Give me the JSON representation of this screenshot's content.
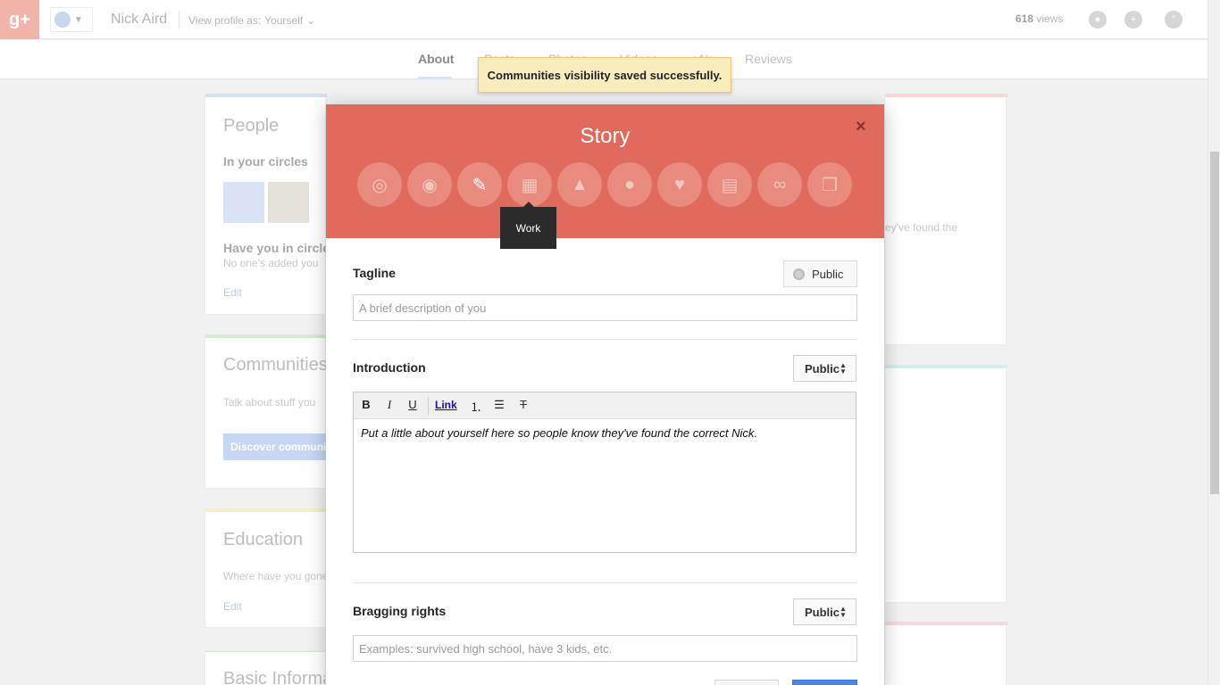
{
  "topbar": {
    "logo": "g+",
    "profile_name": "Nick Aird",
    "view_as_label": "View profile as:",
    "view_as_value": "Yourself",
    "views_count": "618",
    "views_label": "views",
    "icons": [
      "notifications-icon",
      "share-icon",
      "hangouts-icon"
    ]
  },
  "tabs": [
    {
      "label": "About",
      "active": true
    },
    {
      "label": "Posts"
    },
    {
      "label": "Photos"
    },
    {
      "label": "Videos"
    },
    {
      "label": "+1's"
    },
    {
      "label": "Reviews"
    }
  ],
  "toast": {
    "message": "Communities visibility saved successfully."
  },
  "cards": {
    "people": {
      "title": "People",
      "in_circles": "In your circles",
      "have_you": "Have you in circles",
      "no_one": "No one's added you",
      "edit": "Edit"
    },
    "communities": {
      "title": "Communities",
      "text": "Talk about stuff you",
      "button": "Discover communities"
    },
    "education": {
      "title": "Education",
      "text": "Where have you gone",
      "edit": "Edit"
    },
    "basic": {
      "title": "Basic Information"
    },
    "story_snippet": "ey've found the"
  },
  "dialog": {
    "title": "Story",
    "close": "×",
    "categories": [
      {
        "name": "links-icon",
        "glyph": "◎"
      },
      {
        "name": "circles-icon",
        "glyph": "◉"
      },
      {
        "name": "story-icon",
        "glyph": "✎",
        "active": true
      },
      {
        "name": "work-icon",
        "glyph": "▦"
      },
      {
        "name": "education-icon",
        "glyph": "▲"
      },
      {
        "name": "places-icon",
        "glyph": "●"
      },
      {
        "name": "basic-info-icon",
        "glyph": "♥"
      },
      {
        "name": "contact-info-icon",
        "glyph": "▤"
      },
      {
        "name": "chain-links-icon",
        "glyph": "∞"
      },
      {
        "name": "other-profiles-icon",
        "glyph": "❐"
      }
    ],
    "tooltip": "Work",
    "tagline": {
      "label": "Tagline",
      "visibility": "Public",
      "placeholder": "A brief description of you"
    },
    "introduction": {
      "label": "Introduction",
      "visibility": "Public",
      "toolbar": {
        "bold": "B",
        "italic": "I",
        "underline": "U",
        "link": "Link",
        "numbered": "⒈",
        "bulleted": "☰",
        "clear": "T"
      },
      "text": "Put a little about yourself here so people know they've found the correct Nick."
    },
    "bragging": {
      "label": "Bragging rights",
      "visibility": "Public",
      "placeholder": "Examples: survived high school, have 3 kids, etc."
    }
  }
}
